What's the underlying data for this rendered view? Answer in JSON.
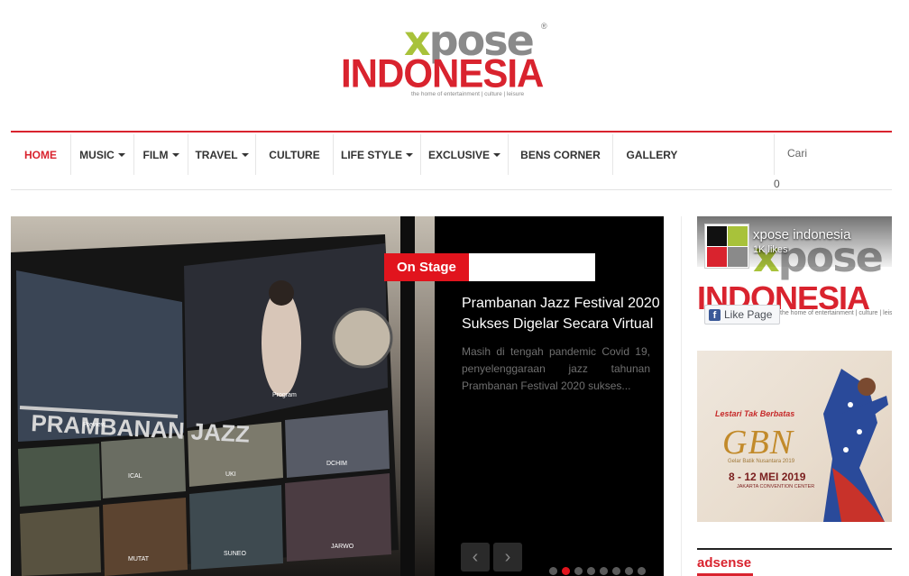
{
  "logo": {
    "x_letter": "x",
    "pose_letters": "pose",
    "registered": "®",
    "wordmark": "INDONESIA",
    "tagline": "the home of entertainment | culture | leisure"
  },
  "nav": {
    "items": [
      {
        "label": "HOME",
        "dropdown": false
      },
      {
        "label": "MUSIC",
        "dropdown": true
      },
      {
        "label": "FILM",
        "dropdown": true
      },
      {
        "label": "TRAVEL",
        "dropdown": true
      },
      {
        "label": "CULTURE",
        "dropdown": false
      },
      {
        "label": "LIFE STYLE",
        "dropdown": true
      },
      {
        "label": "EXCLUSIVE",
        "dropdown": true
      },
      {
        "label": "BENS CORNER",
        "dropdown": false
      },
      {
        "label": "GALLERY",
        "dropdown": false
      }
    ],
    "active": "HOME",
    "search_placeholder": "Cari",
    "search_count": "0"
  },
  "slider": {
    "category": "On Stage",
    "title": "Prambanan Jazz Festival 2020 Sukses Digelar Secara Virtual",
    "excerpt": "Masih di tengah pandemic Covid 19, penyelenggaraan jazz tahunan Prambanan Festival 2020 sukses...",
    "prev_icon": "‹",
    "next_icon": "›",
    "dot_count": 8,
    "active_dot": 2,
    "monitor_labels": [
      "Preview",
      "Program",
      "ICAL",
      "UKI",
      "DCHIM",
      "MUTAT",
      "SUNEO",
      "JARWO"
    ],
    "banner_text": "PRAMBANAN JAZZ"
  },
  "sidebar": {
    "facebook": {
      "page_name": "xpose indonesia",
      "likes": "1K likes",
      "like_button": "Like Page",
      "fb_letter": "f"
    },
    "gbn_ad": {
      "lestari": "Lestari Tak Berbatas",
      "title": "GBN",
      "subtitle": "Gelar Batik Nusantara 2019",
      "date": "8 - 12 MEI 2019",
      "venue": "JAKARTA CONVENTION CENTER"
    },
    "adsense_label": "adsense"
  },
  "colors": {
    "brand_red": "#d9232e",
    "badge_red": "#e1141d",
    "logo_green": "#a8c23a",
    "logo_grey": "#8a8a8a",
    "facebook_blue": "#3b5998"
  }
}
